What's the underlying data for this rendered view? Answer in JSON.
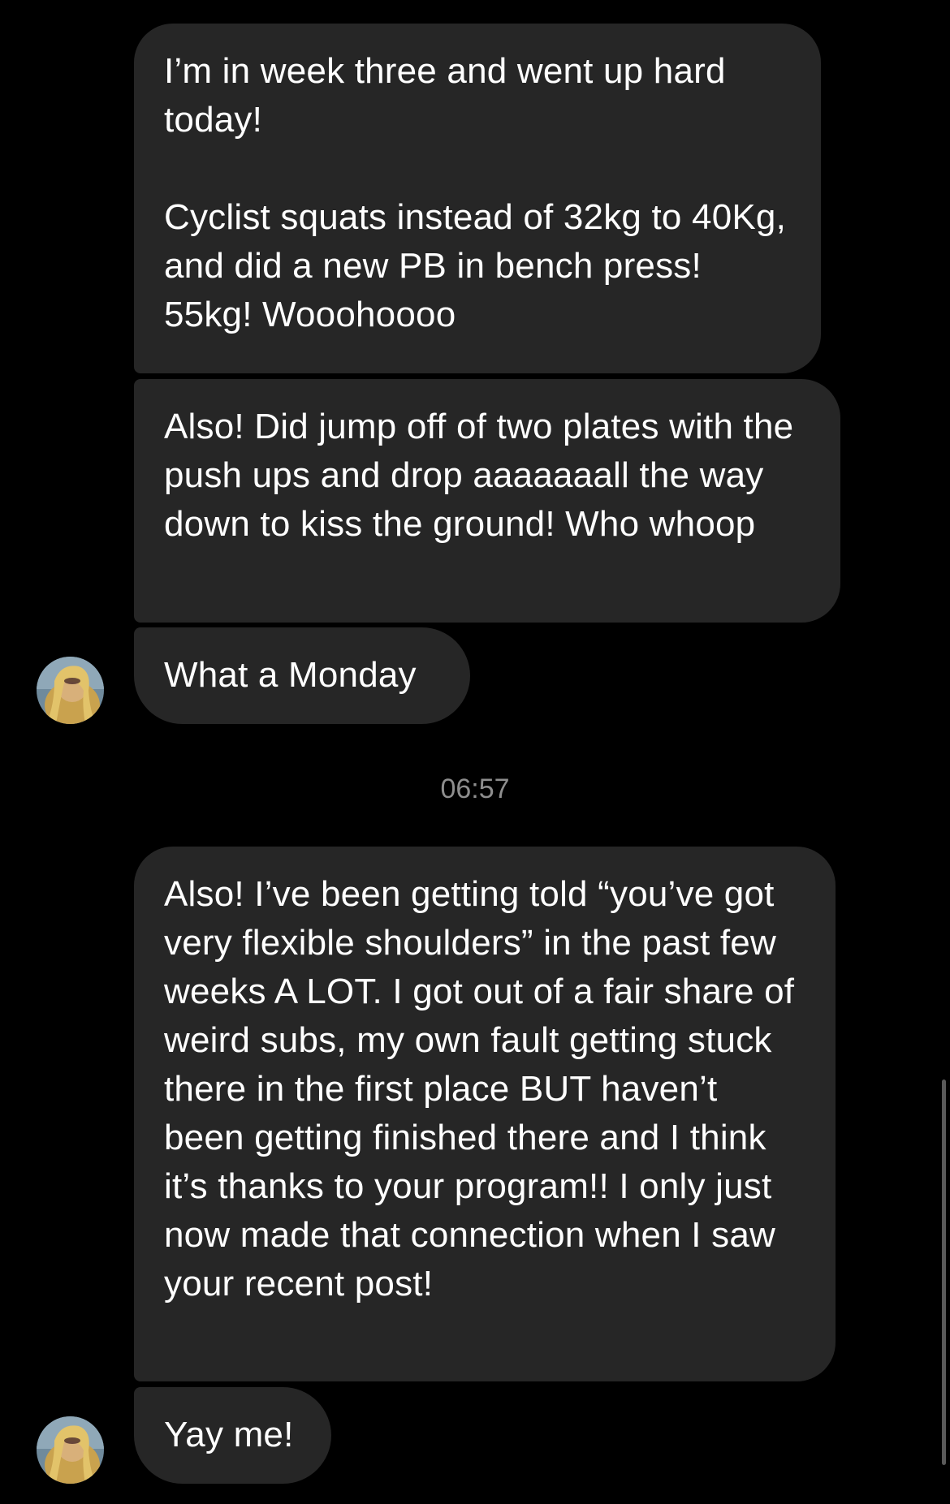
{
  "messages": [
    {
      "text": "I’m in week three and went up hard today!\n\nCyclist squats instead of 32kg to 40Kg, and did a new PB in bench press! 55kg! Wooohoooo"
    },
    {
      "text": "Also! Did jump off of two plates with the push ups and drop aaaaaaall the way down to kiss the ground! Who whoop"
    },
    {
      "text": "What a Monday"
    },
    {
      "text": "Also! I’ve been getting told “you’ve got very flexible shoulders” in the past few weeks A LOT. I got out of a fair share of weird subs, my own fault getting stuck there in the first place BUT haven’t been getting finished there and I think it’s thanks to your program!! I only just now made that connection when I saw your recent post!"
    },
    {
      "text": "Yay me!"
    }
  ],
  "timestamp": "06:57",
  "colors": {
    "background": "#000000",
    "bubble": "#262626",
    "text": "#ffffff",
    "timestamp": "#8e8e8e"
  },
  "icons": {
    "avatar": "user-avatar-photo"
  }
}
